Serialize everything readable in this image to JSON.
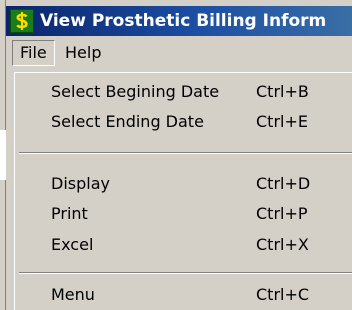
{
  "window": {
    "title": "View Prosthetic Billing Inform",
    "icon": "dollar-sign-icon",
    "colors": {
      "titlebar_start": "#0a246a",
      "titlebar_end": "#3a6ea5",
      "icon_bg": "#1a7d1a",
      "icon_glyph": "#ffd800",
      "face": "#d4d0c8"
    }
  },
  "menubar": {
    "file_label": "File",
    "help_label": "Help"
  },
  "file_menu": {
    "items": [
      {
        "label": "Select Begining Date",
        "shortcut": "Ctrl+B"
      },
      {
        "label": "Select Ending Date",
        "shortcut": "Ctrl+E"
      },
      {
        "label": "Display",
        "shortcut": "Ctrl+D"
      },
      {
        "label": "Print",
        "shortcut": "Ctrl+P"
      },
      {
        "label": "Excel",
        "shortcut": "Ctrl+X"
      },
      {
        "label": "Menu",
        "shortcut": "Ctrl+C"
      }
    ]
  }
}
